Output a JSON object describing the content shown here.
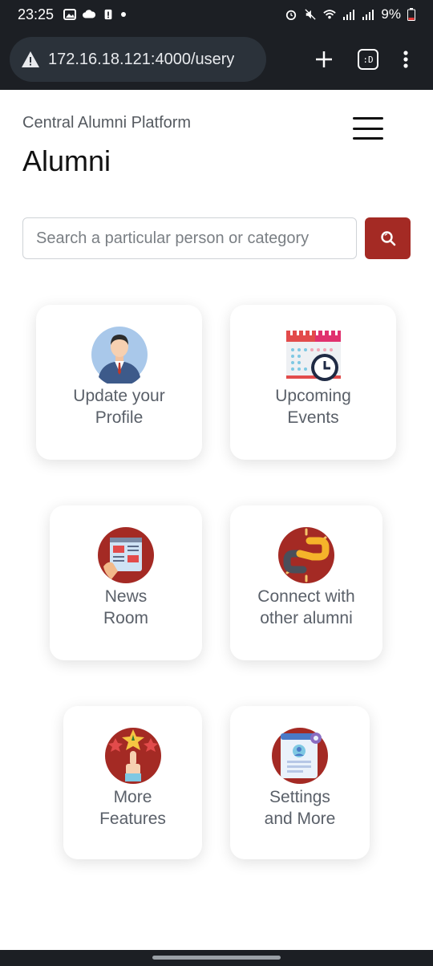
{
  "status_bar": {
    "time": "23:25",
    "battery": "9%"
  },
  "browser": {
    "url": "172.16.18.121:4000/usery",
    "tab_count": ":D"
  },
  "header": {
    "platform_name": "Central Alumni Platform",
    "title": "Alumni"
  },
  "search": {
    "placeholder": "Search a particular person or category"
  },
  "cards": [
    {
      "label": "Update your\nProfile",
      "icon": "profile-person-icon"
    },
    {
      "label": "Upcoming\nEvents",
      "icon": "calendar-clock-icon"
    },
    {
      "label": "News\nRoom",
      "icon": "newspaper-icon"
    },
    {
      "label": "Connect with\nother alumni",
      "icon": "chain-link-icon"
    },
    {
      "label": "More\nFeatures",
      "icon": "star-rating-icon"
    },
    {
      "label": "Settings\nand More",
      "icon": "settings-profile-icon"
    }
  ],
  "colors": {
    "accent": "#a42a24",
    "chrome": "#1c1f24",
    "card_text": "#5a6069"
  }
}
